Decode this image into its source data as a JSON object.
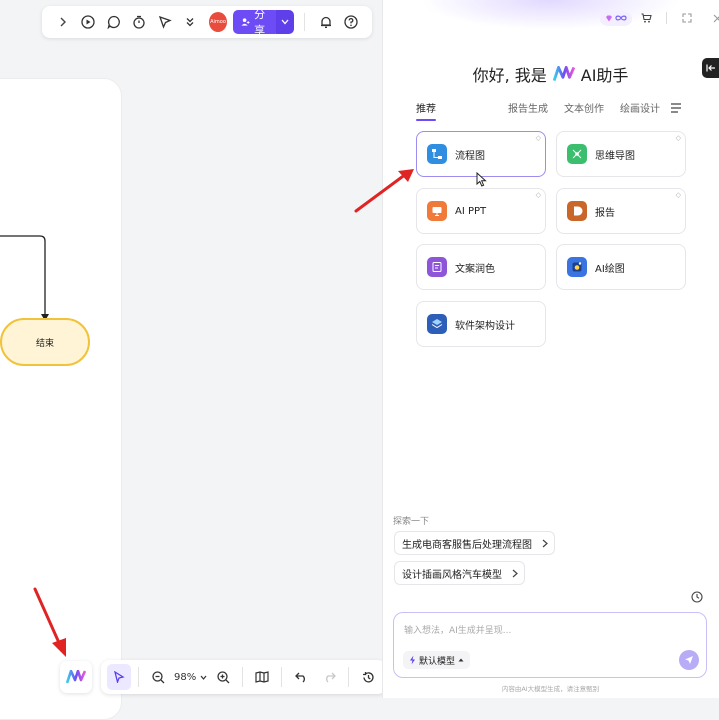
{
  "top_toolbar": {
    "avatar_text": "Aimoo",
    "share_label": "分享"
  },
  "flowchart": {
    "end_node_label": "结束"
  },
  "bottom_toolbar": {
    "zoom": "98%"
  },
  "ai_panel": {
    "greeting_prefix": "你好, 我是",
    "greeting_suffix": "AI助手",
    "tabs": [
      {
        "label": "推荐",
        "active": true
      },
      {
        "label": "报告生成",
        "active": false
      },
      {
        "label": "文本创作",
        "active": false
      },
      {
        "label": "绘画设计",
        "active": false
      }
    ],
    "cards": [
      {
        "label": "流程图",
        "icon": "flowchart-icon",
        "color": "#2f8ee0"
      },
      {
        "label": "思维导图",
        "icon": "mindmap-icon",
        "color": "#3bbf6e"
      },
      {
        "label": "AI PPT",
        "icon": "ppt-icon",
        "color": "#f07a3a"
      },
      {
        "label": "报告",
        "icon": "report-icon",
        "color": "#c9672b"
      },
      {
        "label": "文案润色",
        "icon": "copywriting-icon",
        "color": "#8e55d9"
      },
      {
        "label": "AI绘图",
        "icon": "ai-drawing-icon",
        "color": "#3a74e0"
      },
      {
        "label": "软件架构设计",
        "icon": "architecture-icon",
        "color": "#2d5fb8"
      }
    ],
    "explore_label": "探索一下",
    "suggestions": [
      "生成电商客服售后处理流程图",
      "设计插画风格汽车模型"
    ],
    "input_placeholder": "输入想法，AI生成并呈现...",
    "model_label": "默认模型",
    "footnote": "内容由AI大模型生成，请注意甄别"
  },
  "colors": {
    "accent": "#6d4cf6",
    "end_node_fill": "#fff4d6",
    "end_node_border": "#f1c33a",
    "arrow_red": "#e02424"
  }
}
